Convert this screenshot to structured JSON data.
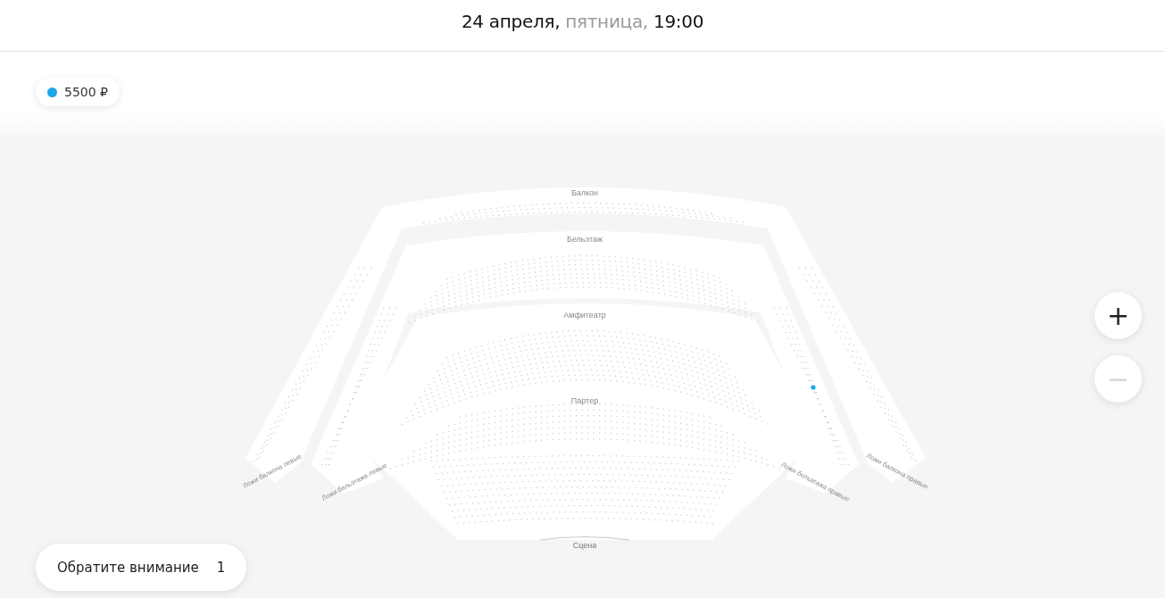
{
  "header": {
    "date": "24 апреля,",
    "weekday": "пятница,",
    "time": "19:00"
  },
  "price_legend": [
    {
      "price": "5500 ₽",
      "color": "#1aa7ec"
    }
  ],
  "hall": {
    "sections": [
      {
        "label": "Балкон"
      },
      {
        "label": "Бельэтаж"
      },
      {
        "label": "Амфитеатр"
      },
      {
        "label": "Партер"
      }
    ],
    "loges": [
      {
        "label": "Ложи балкона левые"
      },
      {
        "label": "Ложи бельэтажа левые"
      },
      {
        "label": "Ложи бельэтажа правые"
      },
      {
        "label": "Ложи балкона правые"
      }
    ],
    "stage": "Сцена"
  },
  "zoom_controls": [
    {
      "symbol": "+",
      "disabled": false
    },
    {
      "symbol": "−",
      "disabled": true
    }
  ],
  "notice": {
    "label": "Обратите внимание",
    "count": "1"
  }
}
